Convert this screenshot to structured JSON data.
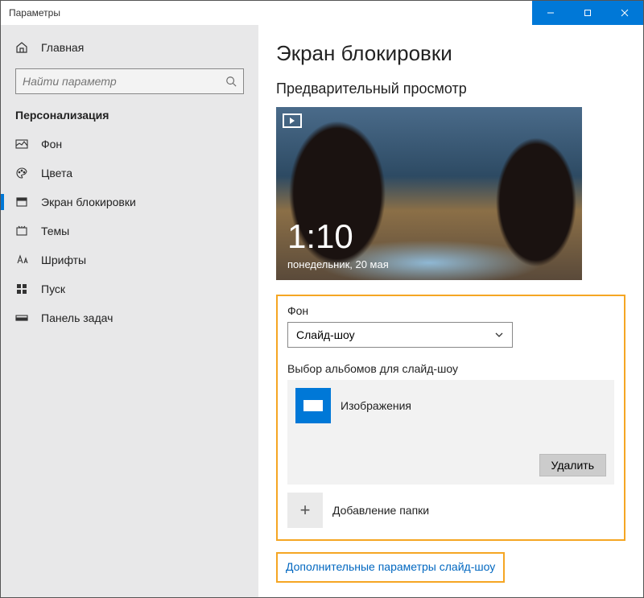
{
  "window": {
    "title": "Параметры"
  },
  "titlebar": {
    "min": "–",
    "max": "▢",
    "close": "✕"
  },
  "sidebar": {
    "home": "Главная",
    "search_placeholder": "Найти параметр",
    "section": "Персонализация",
    "items": [
      {
        "label": "Фон"
      },
      {
        "label": "Цвета"
      },
      {
        "label": "Экран блокировки"
      },
      {
        "label": "Темы"
      },
      {
        "label": "Шрифты"
      },
      {
        "label": "Пуск"
      },
      {
        "label": "Панель задач"
      }
    ]
  },
  "content": {
    "title": "Экран блокировки",
    "preview_label": "Предварительный просмотр",
    "preview_time": "1:10",
    "preview_date": "понедельник, 20 мая",
    "background_label": "Фон",
    "background_value": "Слайд-шоу",
    "albums_label": "Выбор альбомов для слайд-шоу",
    "album_name": "Изображения",
    "remove_label": "Удалить",
    "add_folder_label": "Добавление папки",
    "advanced_link": "Дополнительные параметры слайд-шоу"
  }
}
